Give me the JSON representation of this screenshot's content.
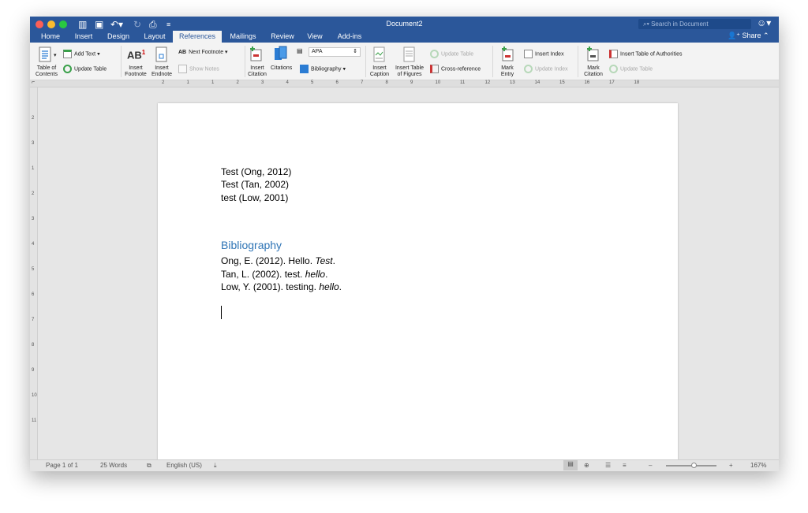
{
  "window": {
    "title": "Document2"
  },
  "search": {
    "placeholder": "Search in Document"
  },
  "share": {
    "label": "Share"
  },
  "tabs": [
    {
      "label": "Home"
    },
    {
      "label": "Insert"
    },
    {
      "label": "Design"
    },
    {
      "label": "Layout"
    },
    {
      "label": "References"
    },
    {
      "label": "Mailings"
    },
    {
      "label": "Review"
    },
    {
      "label": "View"
    },
    {
      "label": "Add-ins"
    }
  ],
  "ribbon": {
    "toc": "Table of\nContents",
    "add_text": "Add Text",
    "update_table": "Update Table",
    "insert_footnote": "Insert\nFootnote",
    "insert_endnote": "Insert\nEndnote",
    "next_footnote": "Next Footnote",
    "show_notes": "Show Notes",
    "insert_citation": "Insert\nCitation",
    "citations": "Citations",
    "style_value": "APA",
    "bibliography": "Bibliography",
    "insert_caption": "Insert\nCaption",
    "insert_tof": "Insert Table\nof Figures",
    "update_table2": "Update Table",
    "cross_reference": "Cross-reference",
    "mark_entry": "Mark\nEntry",
    "insert_index": "Insert Index",
    "update_index": "Update Index",
    "mark_citation": "Mark\nCitation",
    "insert_toa": "Insert Table of Authorities",
    "update_table3": "Update Table"
  },
  "ruler": {
    "numbers": [
      "2",
      "1",
      "1",
      "2",
      "3",
      "4",
      "5",
      "6",
      "7",
      "8",
      "9",
      "10",
      "11",
      "12",
      "13",
      "14",
      "15",
      "16",
      "17",
      "18"
    ]
  },
  "vruler": {
    "numbers": [
      "2",
      "3",
      "1",
      "2",
      "3",
      "4",
      "5",
      "6",
      "7",
      "8",
      "9",
      "10",
      "11"
    ]
  },
  "document": {
    "lines": [
      "Test (Ong, 2012)",
      "Test (Tan, 2002)",
      "test (Low, 2001)"
    ],
    "bibliography_heading": "Bibliography",
    "entries": [
      {
        "text": "Ong, E. (2012). Hello. ",
        "italic": "Test",
        "end": "."
      },
      {
        "text": "Tan, L. (2002). test. ",
        "italic": "hello",
        "end": "."
      },
      {
        "text": "Low, Y. (2001). testing. ",
        "italic": "hello",
        "end": "."
      }
    ]
  },
  "status": {
    "page": "Page 1 of 1",
    "words": "25 Words",
    "language": "English (US)",
    "zoom": "167%"
  },
  "colors": {
    "titlebar": "#2b579a",
    "heading": "#2e74b5"
  }
}
